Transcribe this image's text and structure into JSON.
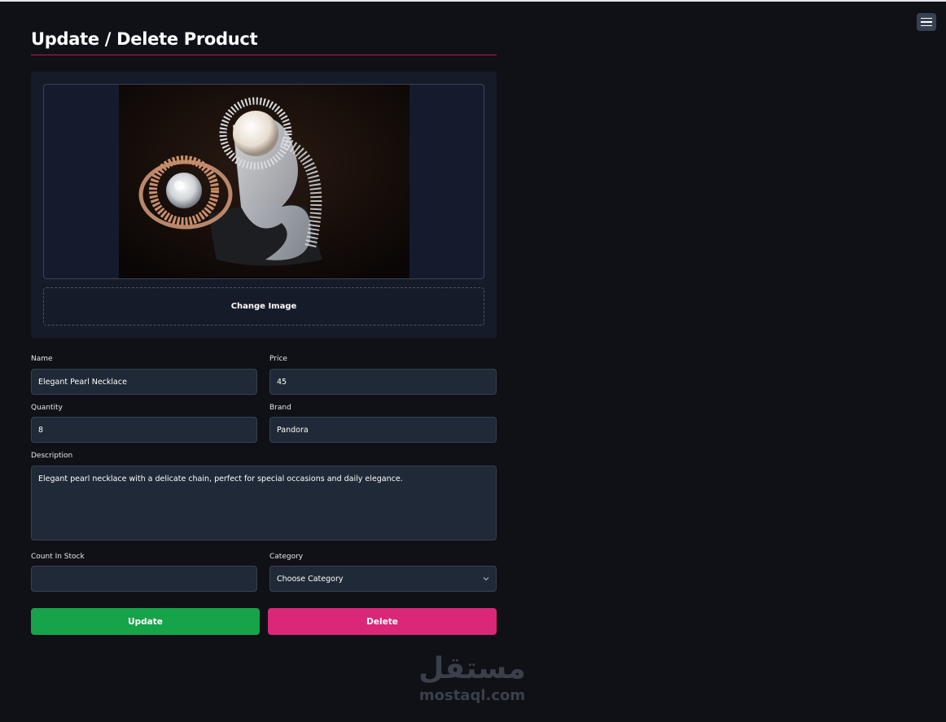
{
  "page": {
    "title": "Update / Delete Product"
  },
  "menu": {
    "icon": "hamburger-menu-icon"
  },
  "image_section": {
    "change_label": "Change Image"
  },
  "form": {
    "name": {
      "label": "Name",
      "value": "Elegant Pearl Necklace"
    },
    "price": {
      "label": "Price",
      "value": "45"
    },
    "quantity": {
      "label": "Quantity",
      "value": "8"
    },
    "brand": {
      "label": "Brand",
      "value": "Pandora"
    },
    "description": {
      "label": "Description",
      "value": "Elegant pearl necklace with a delicate chain, perfect for special occasions and daily elegance."
    },
    "count_in_stock": {
      "label": "Count In Stock",
      "value": ""
    },
    "category": {
      "label": "Category",
      "value": "Choose Category"
    }
  },
  "actions": {
    "update_label": "Update",
    "delete_label": "Delete"
  },
  "watermark": {
    "arabic": "مستقل",
    "latin": "mostaql.com"
  },
  "colors": {
    "background": "#0f1117",
    "accent_rule": "#be185d",
    "update": "#16a34a",
    "delete": "#db2777"
  }
}
